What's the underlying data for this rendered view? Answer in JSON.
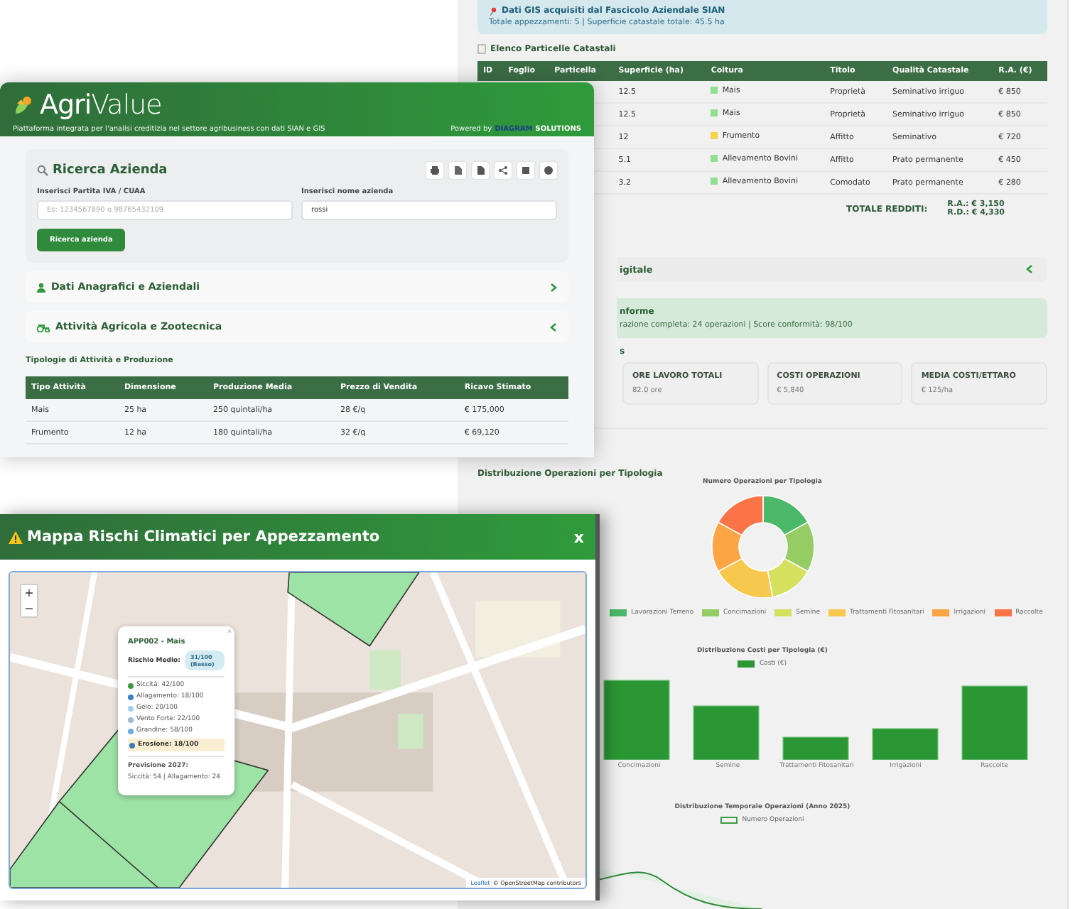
{
  "report_panel": {
    "gis_notice": {
      "title": "Dati GIS acquisiti dal Fascicolo Aziendale SIAN",
      "text": "Totale appezzamenti: 5 | Superficie catastale totale: 45.5 ha"
    },
    "parcels": {
      "title": "Elenco Particelle Catastali",
      "columns": [
        "ID",
        "Foglio",
        "Particella",
        "Superficie (ha)",
        "Coltura",
        "Titolo",
        "Qualità Catastale",
        "R.A. (€)"
      ],
      "rows": [
        {
          "area": "12.5",
          "crop": "Mais",
          "color": "#8fe08f",
          "tenure": "Proprietà",
          "quality": "Seminativo irriguo",
          "ra": "€ 850"
        },
        {
          "area": "12.5",
          "crop": "Mais",
          "color": "#8fe08f",
          "tenure": "Proprietà",
          "quality": "Seminativo irriguo",
          "ra": "€ 850"
        },
        {
          "area": "12",
          "crop": "Frumento",
          "color": "#f5d547",
          "tenure": "Affitto",
          "quality": "Seminativo",
          "ra": "€ 720"
        },
        {
          "area": "5.1",
          "crop": "Allevamento Bovini",
          "color": "#8fe08f",
          "tenure": "Affitto",
          "quality": "Prato permanente",
          "ra": "€ 450"
        },
        {
          "area": "3.2",
          "crop": "Allevamento Bovini",
          "color": "#8fe08f",
          "tenure": "Comodato",
          "quality": "Prato permanente",
          "ra": "€ 280"
        }
      ],
      "total_label": "TOTALE REDDITI:",
      "totals": [
        "R.A.: € 3,150",
        "R.D.: € 4,330"
      ]
    },
    "section": {
      "title": "igitale",
      "expanded": true
    },
    "alert": {
      "title": "nforme",
      "text": "razione completa: 24 operazioni | Score conformità: 98/100"
    },
    "stats_heading": "s",
    "stats": [
      {
        "label": "ORE LAVORO TOTALI",
        "value": "82.0 ore"
      },
      {
        "label": "COSTI OPERAZIONI",
        "value": "€ 5,840"
      },
      {
        "label": "MEDIA COSTI/ETTARO",
        "value": "€ 125/ha"
      }
    ],
    "charts_title": "Distribuzione Operazioni per Tipologia",
    "donut": {
      "title": "Numero Operazioni per Tipologia",
      "legend": [
        {
          "label": "Lavorazioni Terreno",
          "color": "#4cb86a"
        },
        {
          "label": "Concimazioni",
          "color": "#95cc64"
        },
        {
          "label": "Semine",
          "color": "#d4e05e"
        },
        {
          "label": "Trattamenti Fitosanitari",
          "color": "#f7c74e"
        },
        {
          "label": "Irrigazioni",
          "color": "#fba544"
        },
        {
          "label": "Raccolte",
          "color": "#fa7448"
        }
      ]
    },
    "bars": {
      "title": "Distribuzione Costi per Tipologia (€)",
      "legend": "Costi (€)",
      "categories": [
        "Concimazioni",
        "Semine",
        "Trattamenti Fitosanitari",
        "Irrigazioni",
        "Raccolte"
      ]
    },
    "timeline": {
      "title": "Distribuzione Temporale Operazioni (Anno 2025)",
      "legend": "Numero Operazioni"
    }
  },
  "app_window": {
    "logo": "**Agri**Value",
    "tagline": "Piattaforma integrata per l'analisi creditizia nel settore agribusiness con dati SIAN e GIS",
    "powered_by": "Powered by",
    "brand": [
      "DIAGRAM",
      "SOLUTIONS"
    ],
    "search": {
      "title": "Ricerca Azienda",
      "vat_label": "Inserisci Partita IVA / CUAA",
      "vat_placeholder": "Es: 1234567890 o 98765432109",
      "name_label": "Inserisci nome azienda",
      "name_value": "rossi",
      "button": "Ricerca azienda"
    },
    "sections": [
      {
        "title": "Dati Anagrafici e Aziendali",
        "expanded": false
      },
      {
        "title": "Attività Agricola e Zootecnica",
        "expanded": true
      }
    ],
    "activities": {
      "title": "Tipologie di Attività e Produzione",
      "columns": [
        "Tipo Attività",
        "Dimensione",
        "Produzione Media",
        "Prezzo di Vendita",
        "Ricavo Stimato"
      ],
      "rows": [
        [
          "Mais",
          "25 ha",
          "250 quintali/ha",
          "28 €/q",
          "€ 175,000"
        ],
        [
          "Frumento",
          "12 ha",
          "180 quintali/ha",
          "32 €/q",
          "€ 69,120"
        ]
      ]
    }
  },
  "map_modal": {
    "title": "Mappa Rischi Climatici per Appezzamento",
    "close": "x",
    "zoom": [
      "+",
      "−"
    ],
    "popup": {
      "title": "APP002 - Mais",
      "risk_label": "Rischio Medio:",
      "risk_badge": "31/100 (Basso)",
      "risks": [
        {
          "label": "Siccità: 42/100",
          "color": "#3f9a3f",
          "highlighted": false
        },
        {
          "label": "Allagamento: 18/100",
          "color": "#3d7fc4",
          "highlighted": false
        },
        {
          "label": "Gelo: 20/100",
          "color": "#9fd0f0",
          "highlighted": false
        },
        {
          "label": "Vento Forte: 22/100",
          "color": "#a9b8c8",
          "highlighted": false
        },
        {
          "label": "Grandine: 58/100",
          "color": "#6aaede",
          "highlighted": false
        },
        {
          "label": "Erosione: 18/100",
          "color": "#3a7ac0",
          "highlighted": true
        }
      ],
      "forecast_title": "Previsione 2027:",
      "forecast": "Siccità: 54 | Allagamento: 24",
      "close": "×"
    },
    "attribution": [
      "Leaflet",
      "© OpenStreetMap contributors"
    ]
  }
}
